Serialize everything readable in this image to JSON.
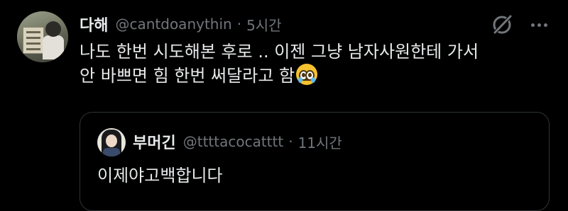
{
  "tweet": {
    "author_name": "다해",
    "handle": "@cantdoanythin",
    "separator": "·",
    "time": "5시간",
    "text_line1": "나도 한번 시도해본 후로 .. 이젠 그냥 남자사원한테 가서",
    "text_line2": "안 바쁘면 힘 한번 써달라고 함",
    "emoji": "pleading-face-with-tears",
    "icons": [
      "grok-icon",
      "more-icon"
    ]
  },
  "quote": {
    "author_name": "부머긴",
    "handle": "@ttttacocatttt",
    "separator": "·",
    "time": "11시간",
    "text": "이제야고백합니다"
  },
  "colors": {
    "background": "#000000",
    "primary_text": "#e7e9ea",
    "secondary_text": "#71767b",
    "border": "#2f3336"
  }
}
